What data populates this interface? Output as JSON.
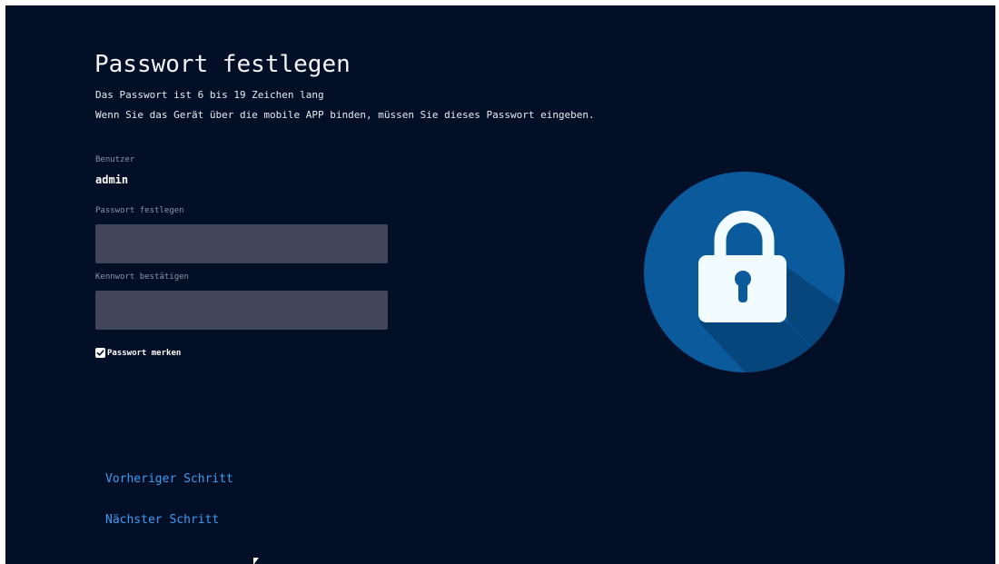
{
  "header": {
    "title": "Passwort festlegen",
    "description_line1": "Das Passwort ist 6 bis 19 Zeichen lang",
    "description_line2": "Wenn Sie das Gerät über die mobile APP binden, müssen Sie dieses Passwort eingeben."
  },
  "form": {
    "user_label": "Benutzer",
    "user_value": "admin",
    "password_label": "Passwort festlegen",
    "password_value": "",
    "confirm_label": "Kennwort bestätigen",
    "confirm_value": "",
    "remember_label": "Passwort merken",
    "remember_checked": true
  },
  "navigation": {
    "previous_label": "Vorheriger Schritt",
    "next_label": "Nächster Schritt"
  },
  "illustration": {
    "icon": "padlock-icon",
    "circle_color": "#0a5a9c",
    "shadow_color": "#07467d",
    "lock_color": "#f2fbff"
  },
  "colors": {
    "background": "#020f26",
    "input_background": "#42465a",
    "link": "#3b9cf0",
    "muted_label": "#8c96a8"
  }
}
